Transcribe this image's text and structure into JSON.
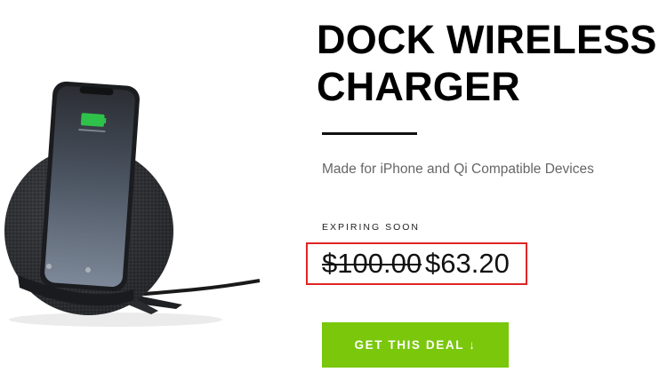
{
  "product": {
    "title_line1": "DOCK WIRELESS",
    "title_line2": "CHARGER",
    "subtitle": "Made for iPhone and Qi Compatible Devices",
    "image_icon": "phone-on-wireless-charger-dock"
  },
  "offer": {
    "label": "EXPIRING SOON",
    "original_price": "$100.00",
    "sale_price": "$63.20",
    "highlight_color": "#e02424"
  },
  "cta": {
    "label": "GET THIS DEAL ↓",
    "color": "#7ac70c"
  }
}
